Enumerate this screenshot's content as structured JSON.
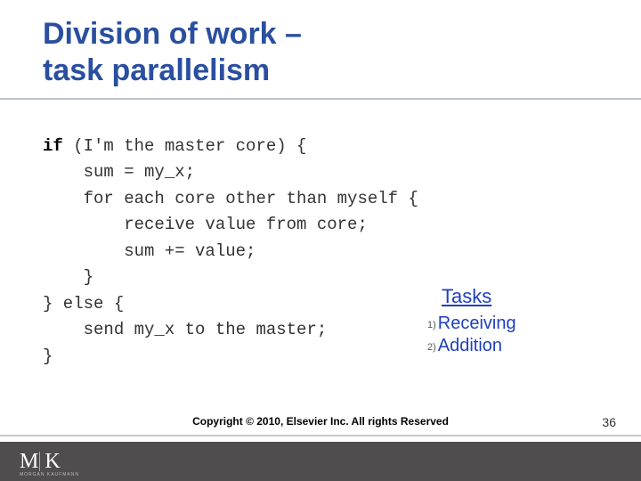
{
  "title": {
    "line1": "Division of work –",
    "line2": "task parallelism"
  },
  "code": {
    "l1a": "if",
    "l1b": " (I'm the master core) {",
    "l2": "    sum = my_x;",
    "l3": "    for each core other than myself {",
    "l4": "        receive value from core;",
    "l5": "        sum += value;",
    "l6": "    }",
    "l7": "} else {",
    "l8": "    send my_x to the master;",
    "l9": "}"
  },
  "tasks": {
    "heading": "Tasks",
    "items": [
      {
        "num": "1)",
        "label": "Receiving"
      },
      {
        "num": "2)",
        "label": "Addition"
      }
    ]
  },
  "footer": {
    "copyright": "Copyright © 2010, Elsevier Inc. All rights Reserved",
    "page": "36",
    "logo_sub": "MORGAN KAUFMANN"
  }
}
